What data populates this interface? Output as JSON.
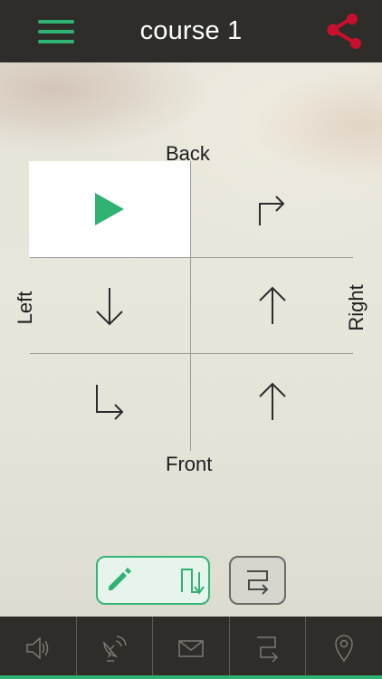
{
  "header": {
    "title": "course 1",
    "menu_icon": "hamburger-menu-icon",
    "share_icon": "share-icon"
  },
  "labels": {
    "back": "Back",
    "front": "Front",
    "left": "Left",
    "right": "Right"
  },
  "grid": {
    "cells": [
      {
        "position": "top-left",
        "icon": "play-icon",
        "selected": true
      },
      {
        "position": "top-right",
        "icon": "turn-right-arrow-icon",
        "selected": false
      },
      {
        "position": "middle-left",
        "icon": "arrow-down-icon",
        "selected": false
      },
      {
        "position": "middle-right",
        "icon": "arrow-up-icon",
        "selected": false
      },
      {
        "position": "bottom-left",
        "icon": "down-then-right-arrow-icon",
        "selected": false
      },
      {
        "position": "bottom-right",
        "icon": "arrow-up-icon",
        "selected": false
      }
    ]
  },
  "controls": {
    "mode_button_icons": [
      "pencil-icon",
      "path-down-icon"
    ],
    "loop_button_icon": "route-icon"
  },
  "footer": {
    "items": [
      "speaker-icon",
      "satellite-dish-icon",
      "mail-icon",
      "route-icon",
      "location-pin-icon"
    ]
  },
  "colors": {
    "accent_green": "#2fb373",
    "share_red": "#c8102e",
    "bar_dark": "#2e2d2a"
  }
}
